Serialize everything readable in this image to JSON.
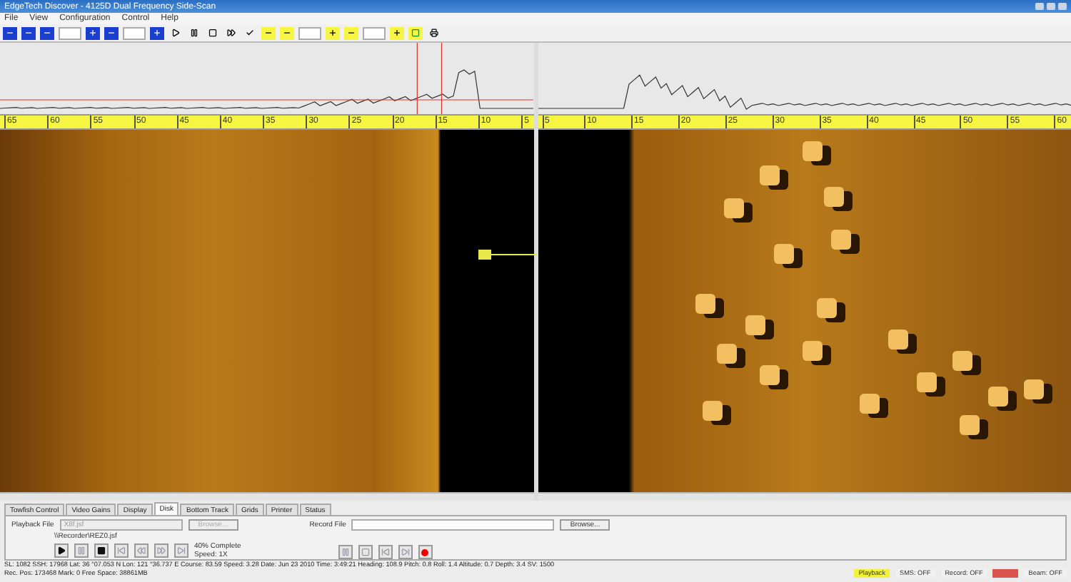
{
  "window": {
    "title": "EdgeTech Discover - 4125D Dual Frequency Side-Scan"
  },
  "menu": [
    "File",
    "View",
    "Configuration",
    "Control",
    "Help"
  ],
  "rulers": {
    "port": [
      "65",
      "60",
      "55",
      "50",
      "45",
      "40",
      "35",
      "30",
      "25",
      "20",
      "15",
      "10",
      "5"
    ],
    "starboard": [
      "5",
      "10",
      "15",
      "20",
      "25",
      "30",
      "35",
      "40",
      "45",
      "50",
      "55",
      "60"
    ]
  },
  "tabs": [
    {
      "label": "Towfish Control",
      "selected": false
    },
    {
      "label": "Video Gains",
      "selected": false
    },
    {
      "label": "Display",
      "selected": false
    },
    {
      "label": "Disk",
      "selected": true
    },
    {
      "label": "Bottom Track",
      "selected": false
    },
    {
      "label": "Grids",
      "selected": false
    },
    {
      "label": "Printer",
      "selected": false
    },
    {
      "label": "Status",
      "selected": false
    }
  ],
  "disk": {
    "playback_label": "Playback File",
    "playback_value": "X8f.jsf",
    "browse_disabled": "Browse...",
    "path": "\\\\Recorder\\REZ0.jsf",
    "progress": "40% Complete",
    "speed": "Speed: 1X",
    "record_label": "Record File",
    "browse": "Browse..."
  },
  "status_line_1": "SL: 1082 SSH: 17968  Lat: 36 °07.053 N  Lon: 121 °36.737 E  Course: 83.59  Speed: 3.28  Date: Jun 23 2010  Time: 3:49:21  Heading: 108.9  Pitch: 0.8  Roll: 1.4  Altitude: 0.7  Depth: 3.4  SV: 1500",
  "status_line_2": "Rec. Pos: 173468  Mark: 0     Free Space: 38861MB",
  "indicators": [
    {
      "label": "Playback",
      "color": "#f2f23a"
    },
    {
      "label": "SMS: OFF",
      "color": "#f0f0f0"
    },
    {
      "label": "Record: OFF",
      "color": "#f0f0f0"
    },
    {
      "color": "#d9534f"
    },
    {
      "label": "Beam: OFF",
      "color": "#f0f0f0"
    }
  ]
}
